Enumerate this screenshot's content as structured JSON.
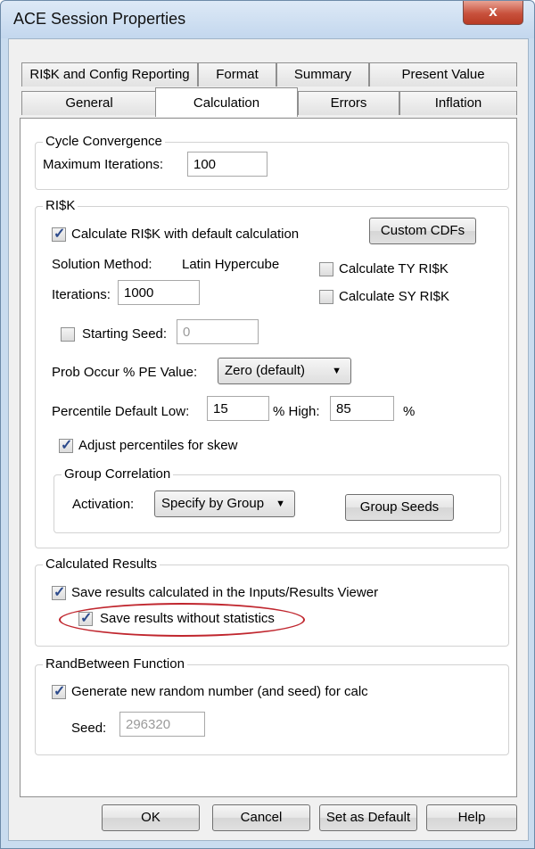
{
  "window": {
    "title": "ACE Session Properties",
    "close_label": "x"
  },
  "tabs": {
    "row1": [
      "RI$K and Config Reporting",
      "Format",
      "Summary",
      "Present Value"
    ],
    "row2": [
      "General",
      "Calculation",
      "Errors",
      "Inflation"
    ],
    "active": "Calculation"
  },
  "cycle": {
    "legend": "Cycle Convergence",
    "max_iter_label": "Maximum Iterations:",
    "max_iter_value": "100"
  },
  "risk": {
    "legend": "RI$K",
    "calc_default_label": "Calculate RI$K with default calculation",
    "calc_default_checked": true,
    "custom_cdfs": "Custom CDFs",
    "solution_method_label": "Solution Method:",
    "solution_method_value": "Latin Hypercube",
    "calc_ty_label": "Calculate TY RI$K",
    "calc_sy_label": "Calculate SY RI$K",
    "iterations_label": "Iterations:",
    "iterations_value": "1000",
    "starting_seed_label": "Starting Seed:",
    "starting_seed_value": "0",
    "prob_occur_label": "Prob Occur % PE Value:",
    "prob_occur_value": "Zero (default)",
    "percentile_label": "Percentile Default Low:",
    "low_value": "15",
    "high_label": "% High:",
    "high_value": "85",
    "pct_suffix": "%",
    "adjust_label": "Adjust percentiles for skew",
    "adjust_checked": true,
    "group_corr": {
      "legend": "Group Correlation",
      "activation_label": "Activation:",
      "activation_value": "Specify by Group",
      "group_seeds": "Group Seeds"
    }
  },
  "calculated": {
    "legend": "Calculated Results",
    "save_results_label": "Save results calculated in the Inputs/Results Viewer",
    "save_no_stats_label": "Save results without statistics"
  },
  "randbetween": {
    "legend": "RandBetween Function",
    "generate_label": "Generate new random number (and seed) for calc",
    "seed_label": "Seed:",
    "seed_value": "296320"
  },
  "buttons": {
    "ok": "OK",
    "cancel": "Cancel",
    "set_default": "Set as Default",
    "help": "Help"
  },
  "colors": {
    "highlight_ellipse": "#c0262e",
    "check_mark": "#2c4a8c"
  }
}
